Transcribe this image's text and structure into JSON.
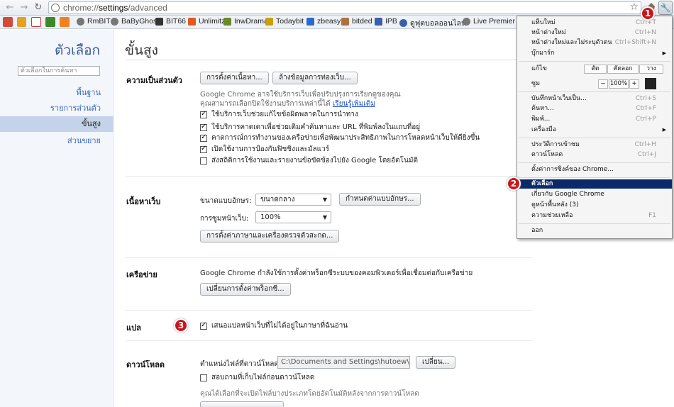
{
  "browser": {
    "back_icon": "back-arrow-icon",
    "forward_icon": "forward-arrow-icon",
    "reload_icon": "reload-icon",
    "url_scheme": "chrome://",
    "url_host": "settings",
    "url_path": "/advanced",
    "star_icon": "star-icon",
    "wrench_icon": "wrench-icon"
  },
  "bookmarks": [
    {
      "label": "RmBIT",
      "color": "#555555"
    },
    {
      "label": "BaByGhost",
      "color": "#555555"
    },
    {
      "label": "BIT66",
      "color": "#333333"
    },
    {
      "label": "Unlimitz",
      "color": "#e05a20"
    },
    {
      "label": "InwDrama",
      "color": "#6a8a2a"
    },
    {
      "label": "Todaybit",
      "color": "#c8a000"
    },
    {
      "label": "zbeasy",
      "color": "#2a6acc"
    },
    {
      "label": "bitded",
      "color": "#b07040"
    },
    {
      "label": "IPB",
      "color": "#3a5fa8"
    },
    {
      "label": "ดูฟุตบอลออนไลน์",
      "color": "#3a5fa8"
    },
    {
      "label": "Live Premier socc",
      "color": "#555555"
    }
  ],
  "sidebar": {
    "title": "ตัวเลือก",
    "search_placeholder": "ตัวเลือกในการค้นหา",
    "items": [
      {
        "label": "พื้นฐาน",
        "active": false
      },
      {
        "label": "รายการส่วนตัว",
        "active": false
      },
      {
        "label": "ขั้นสูง",
        "active": true
      },
      {
        "label": "ส่วนขยาย",
        "active": false
      }
    ]
  },
  "main": {
    "title": "ขั้นสูง",
    "privacy": {
      "heading": "ความเป็นส่วนตัว",
      "content_settings_button": "การตั้งค่าเนื้อหา...",
      "clear_data_button": "ล้างข้อมูลการท่องเว็บ...",
      "description": "Google Chrome อาจใช้บริการเว็บเพื่อปรับปรุงการเรียกดูของคุณ คุณสามารถเลือกปิดใช้งานบริการเหล่านี้ได้",
      "learn_more": "เรียนรู้เพิ่มเติม",
      "options": [
        {
          "label": "ใช้บริการเว็บช่วยแก้ไขข้อผิดพลาดในการนำทาง",
          "checked": true
        },
        {
          "label": "ใช้บริการคาดเดาเพื่อช่วยเติมคำค้นหาและ URL ที่พิมพ์ลงในแถบที่อยู่",
          "checked": true
        },
        {
          "label": "คาดการณ์การทำงานของเครือข่ายเพื่อพัฒนาประสิทธิภาพในการโหลดหน้าเว็บให้ดียิ่งขึ้น",
          "checked": true
        },
        {
          "label": "เปิดใช้งานการป้องกันฟิชชิงและมัลแวร์",
          "checked": true
        },
        {
          "label": "ส่งสถิติการใช้งานและรายงานข้อขัดข้องไปยัง Google โดยอัตโนมัติ",
          "checked": false
        }
      ]
    },
    "web_content": {
      "heading": "เนื้อหาเว็บ",
      "font_size_label": "ขนาดแบบอักษร:",
      "font_size_value": "ขนาดกลาง",
      "customize_fonts_button": "กำหนดค่าแบบอักษร...",
      "zoom_label": "การซูมหน้าเว็บ:",
      "zoom_value": "100%",
      "language_button": "การตั้งค่าภาษาและเครื่องตรวจตัวสะกด..."
    },
    "network": {
      "heading": "เครือข่าย",
      "description": "Google Chrome กำลังใช้การตั้งค่าพร็อกซีระบบของคอมพิวเตอร์เพื่อเชื่อมต่อกับเครือข่าย",
      "proxy_button": "เปลี่ยนการตั้งค่าพร็อกซี..."
    },
    "translate": {
      "heading": "แปล",
      "option": "เสนอแปลหน้าเว็บที่ไม่ได้อยู่ในภาษาที่ฉันอ่าน",
      "checked": true
    },
    "downloads": {
      "heading": "ดาวน์โหลด",
      "location_label": "ตำแหน่งไฟล์ที่ดาวน์โหลด:",
      "location_value": "C:\\Documents and Settings\\hutoew\\Deskto",
      "change_button": "เปลี่ยน...",
      "ask_option": "สอบถามที่เก็บไฟล์ก่อนดาวน์โหลด",
      "ask_checked": false,
      "auto_open_note": "คุณได้เลือกที่จะเปิดไฟล์บางประเภทโดยอัตโนมัติหลังจากการดาวน์โหลด"
    }
  },
  "menu": {
    "new_tab": "แท็บใหม่",
    "new_tab_sc": "Ctrl+T",
    "new_window": "หน้าต่างใหม่",
    "new_window_sc": "Ctrl+N",
    "incognito": "หน้าต่างใหม่และไม่ระบุตัวตน",
    "incognito_sc": "Ctrl+Shift+N",
    "bookmarks": "บุ๊กมาร์ก",
    "edit_label": "แก้ไข",
    "cut": "ตัด",
    "copy": "คัดลอก",
    "paste": "วาง",
    "zoom_label": "ซูม",
    "zoom_minus": "−",
    "zoom_value": "100%",
    "zoom_plus": "+",
    "save_page": "บันทึกหน้าเว็บเป็น...",
    "save_page_sc": "Ctrl+S",
    "find": "ค้นหา...",
    "find_sc": "Ctrl+F",
    "print": "พิมพ์...",
    "print_sc": "Ctrl+P",
    "tools": "เครื่องมือ",
    "history": "ประวัติการเข้าชม",
    "history_sc": "Ctrl+H",
    "downloads": "ดาวน์โหลด",
    "downloads_sc": "Ctrl+J",
    "sync": "ตั้งค่าการซิงค์ของ Chrome...",
    "options": "ตัวเลือก",
    "about": "เกี่ยวกับ Google Chrome",
    "background_pages": "ดูหน้าพื้นหลัง (3)",
    "help": "ความช่วยเหลือ",
    "help_sc": "F1",
    "exit": "ออก"
  },
  "markers": [
    "1",
    "2",
    "3"
  ],
  "colors": {
    "accent": "#3a68c8",
    "marker": "#c8161d",
    "menu_highlight": "#0a2a6a"
  }
}
